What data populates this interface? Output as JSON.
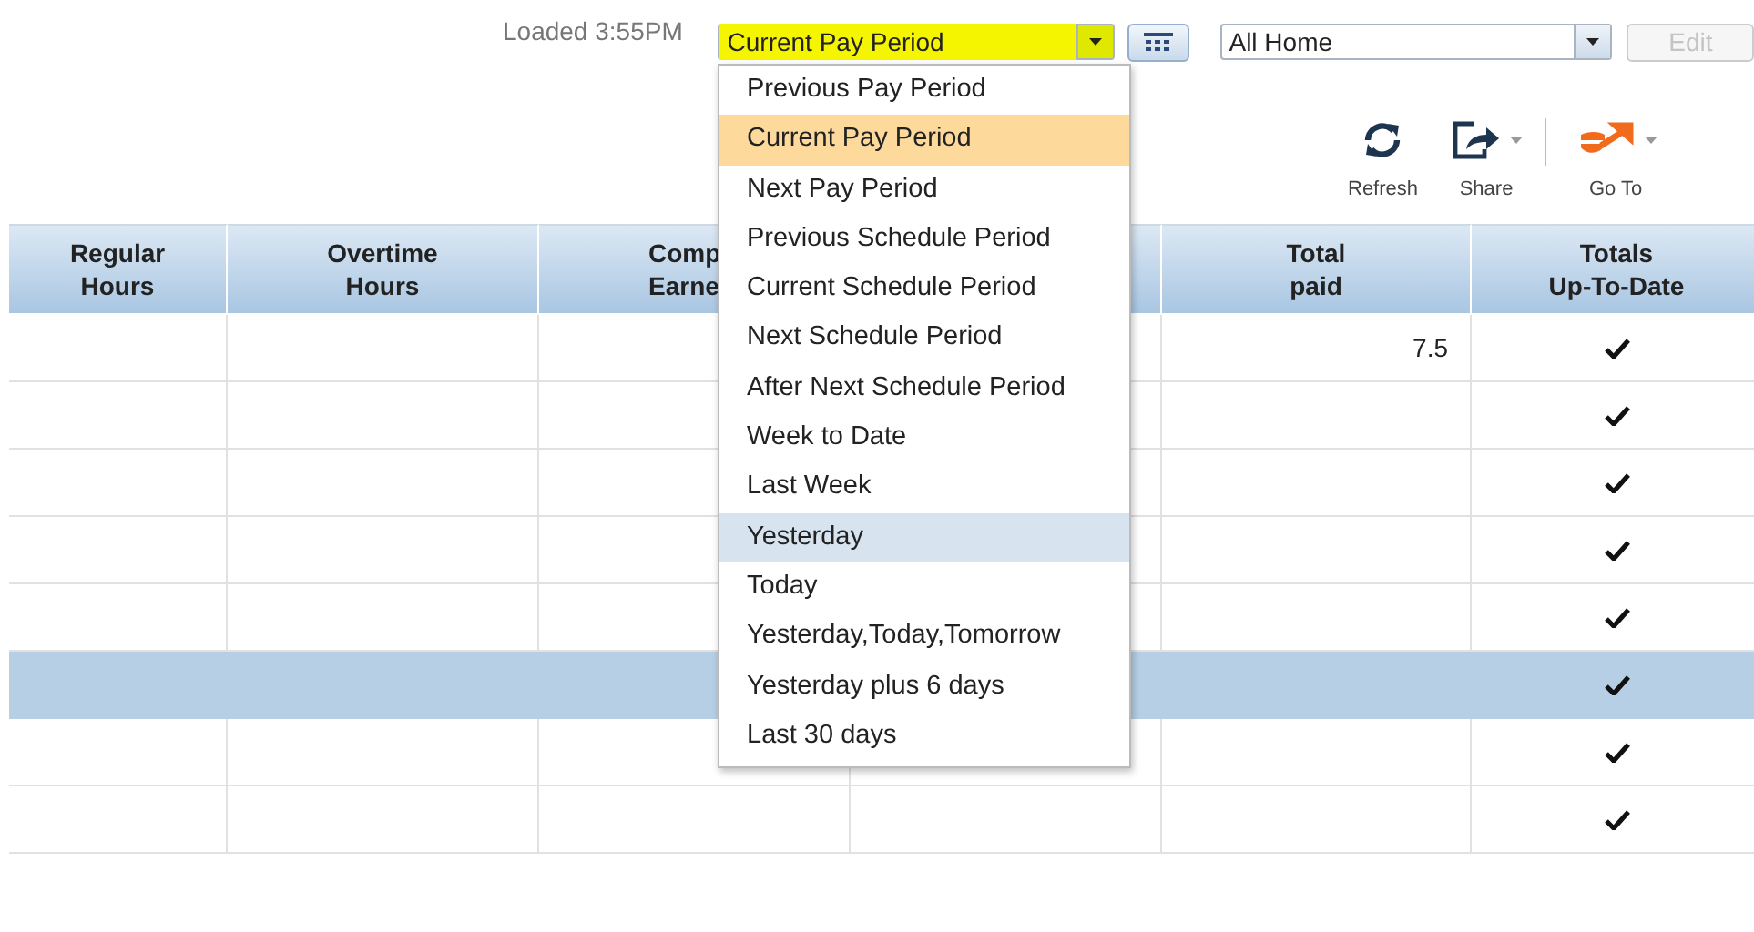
{
  "header": {
    "loaded": "Loaded 3:55PM",
    "period": {
      "value": "Current Pay Period",
      "highlighted": true
    },
    "location": {
      "value": "All Home"
    },
    "edit_button": {
      "label": "Edit",
      "disabled": true
    }
  },
  "toolbar": [
    {
      "label": "Refresh",
      "kind": "refresh",
      "has_menu": false
    },
    {
      "label": "Share",
      "kind": "share",
      "has_menu": true
    },
    {
      "label": "Go To",
      "kind": "goto",
      "has_menu": true
    }
  ],
  "period_menu": [
    {
      "label": "Previous Pay Period",
      "selected": false,
      "hovered": false
    },
    {
      "label": "Current Pay Period",
      "selected": true,
      "hovered": false
    },
    {
      "label": "Next Pay Period",
      "selected": false,
      "hovered": false
    },
    {
      "label": "Previous Schedule Period",
      "selected": false,
      "hovered": false
    },
    {
      "label": "Current Schedule Period",
      "selected": false,
      "hovered": false
    },
    {
      "label": "Next Schedule Period",
      "selected": false,
      "hovered": false
    },
    {
      "label": "After Next Schedule Period",
      "selected": false,
      "hovered": false
    },
    {
      "label": "Week to Date",
      "selected": false,
      "hovered": false
    },
    {
      "label": "Last Week",
      "selected": false,
      "hovered": false
    },
    {
      "label": "Yesterday",
      "selected": false,
      "hovered": true
    },
    {
      "label": "Today",
      "selected": false,
      "hovered": false
    },
    {
      "label": "Yesterday,Today,Tomorrow",
      "selected": false,
      "hovered": false
    },
    {
      "label": "Yesterday plus 6 days",
      "selected": false,
      "hovered": false
    },
    {
      "label": "Last 30 days",
      "selected": false,
      "hovered": false
    }
  ],
  "table": {
    "columns": [
      {
        "lines": [
          "Regular",
          "Hours"
        ]
      },
      {
        "lines": [
          "Overtime",
          "Hours"
        ]
      },
      {
        "lines": [
          "Comp",
          "Earne"
        ],
        "covered": true
      },
      {},
      {
        "lines": [
          "Total",
          "paid"
        ]
      },
      {
        "lines": [
          "Totals",
          "Up-To-Date"
        ]
      }
    ],
    "rows": [
      {
        "total_paid": "7.5",
        "up_to_date": true,
        "selected": false
      },
      {
        "up_to_date": true,
        "selected": false
      },
      {
        "up_to_date": true,
        "selected": false
      },
      {
        "up_to_date": true,
        "selected": false
      },
      {
        "up_to_date": true,
        "selected": false
      },
      {
        "up_to_date": true,
        "selected": true
      },
      {
        "up_to_date": true,
        "selected": false
      },
      {
        "up_to_date": true,
        "selected": false
      }
    ]
  }
}
